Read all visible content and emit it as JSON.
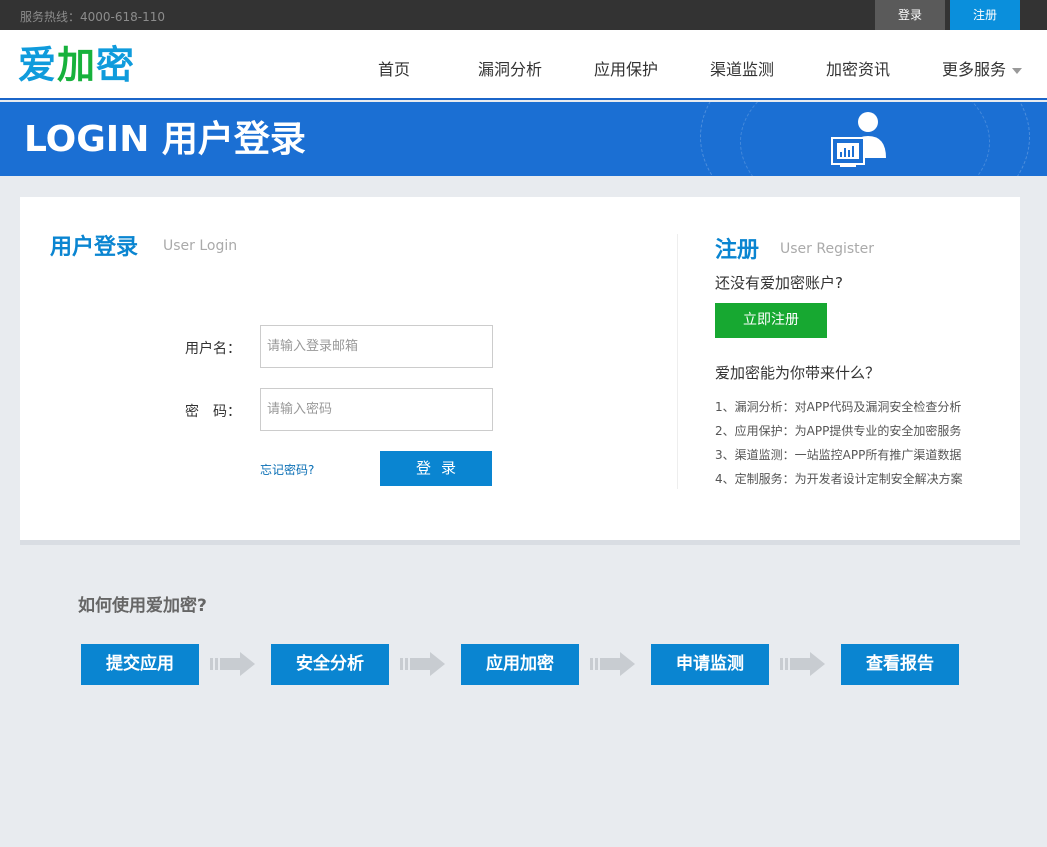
{
  "topbar": {
    "hotline": "服务热线：4000-618-110",
    "login_label": "登录",
    "register_label": "注册"
  },
  "header": {
    "logo": [
      "爱",
      "加",
      "密"
    ],
    "nav": [
      "首页",
      "漏洞分析",
      "应用保护",
      "渠道监测",
      "加密资讯",
      "更多服务"
    ]
  },
  "banner": {
    "title": "LOGIN 用户登录"
  },
  "login": {
    "title": "用户登录",
    "subtitle": "User Login",
    "username_label": "用户名：",
    "username_placeholder": "请输入登录邮箱",
    "password_label": "密　码：",
    "password_placeholder": "请输入密码",
    "forgot": "忘记密码?",
    "submit": "登录"
  },
  "register": {
    "title": "注册",
    "subtitle": "User Register",
    "question": "还没有爱加密账户?",
    "button": "立即注册",
    "benefits_title": "爱加密能为你带来什么？",
    "benefits": [
      "1、漏洞分析：对APP代码及漏洞安全检查分析",
      "2、应用保护：为APP提供专业的安全加密服务",
      "3、渠道监测：一站监控APP所有推广渠道数据",
      "4、定制服务：为开发者设计定制安全解决方案"
    ]
  },
  "howto": {
    "title": "如何使用爱加密?",
    "steps": [
      "提交应用",
      "安全分析",
      "应用加密",
      "申请监测",
      "查看报告"
    ]
  },
  "colors": {
    "brand_blue": "#0a85d1",
    "banner_blue": "#1b6fd3",
    "brand_green": "#17a831",
    "topbar_bg": "#333333"
  }
}
